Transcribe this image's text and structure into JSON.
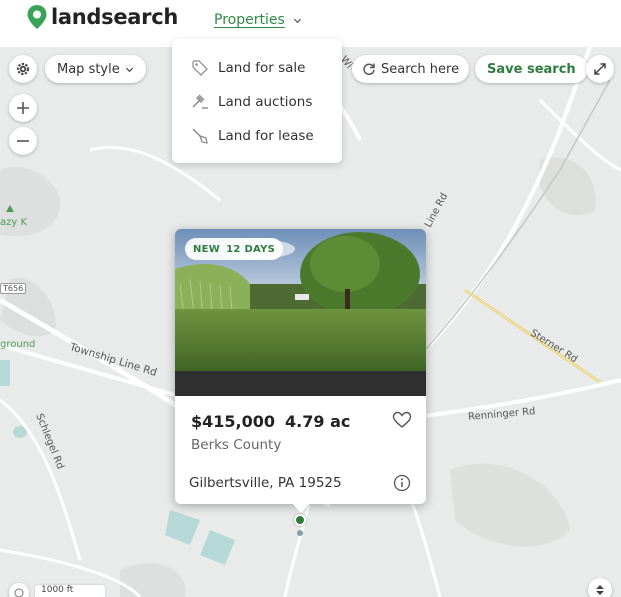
{
  "header": {
    "logo_text": "landsearch",
    "nav_properties": "Properties"
  },
  "dropdown": {
    "items": [
      {
        "label": "Land for sale",
        "icon": "tag-icon"
      },
      {
        "label": "Land auctions",
        "icon": "gavel-icon"
      },
      {
        "label": "Land for lease",
        "icon": "shovel-icon"
      }
    ]
  },
  "map_controls": {
    "map_style": "Map style",
    "search_here": "Search here",
    "save_search": "Save search"
  },
  "map_labels": {
    "township_line_rd": "Township Line Rd",
    "line_rd": "Line Rd",
    "sterner_rd": "Sterner Rd",
    "renninger_rd": "Renninger Rd",
    "schlegel_rd": "Schlegel Rd",
    "t656": "T656",
    "ground": "ground",
    "azy_k": "azy K",
    "wi": "Wi",
    "scale": "1000 ft"
  },
  "listing": {
    "badge_new": "NEW",
    "badge_days": "12 DAYS",
    "price": "$415,000",
    "acreage": "4.79 ac",
    "county": "Berks County",
    "address": "Gilbertsville, PA 19525"
  },
  "colors": {
    "brand_green": "#2f7d3e",
    "nav_green": "#2f8a45",
    "map_bg": "#e9ebea"
  }
}
